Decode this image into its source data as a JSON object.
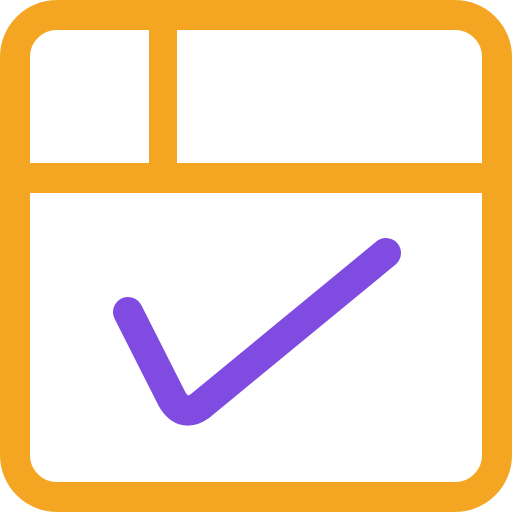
{
  "icon": {
    "name": "calendar-check-icon",
    "frame_color": "#F4A522",
    "check_color": "#7F4BE1",
    "background_color": "#FFFFFF"
  }
}
